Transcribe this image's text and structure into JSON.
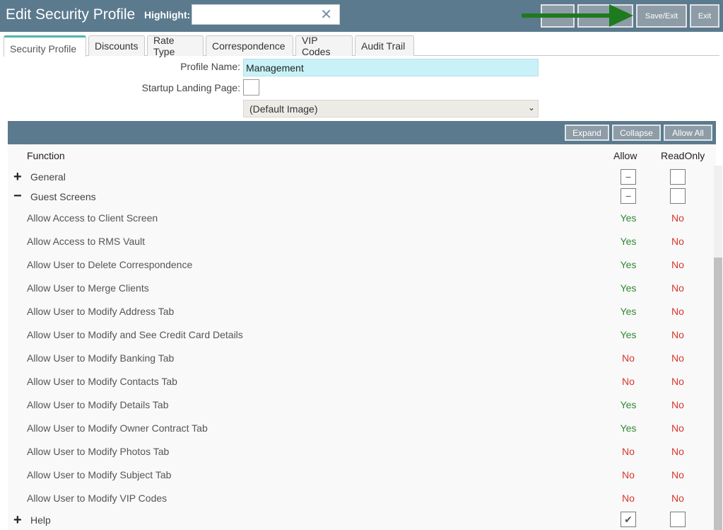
{
  "header": {
    "title": "Edit Security Profile",
    "highlight_label": "Highlight:",
    "highlight_value": "",
    "clear_icon": "close-icon",
    "buttons": [
      "",
      "",
      "Save/Exit",
      "Exit"
    ],
    "arrow_color": "#1e7a1e"
  },
  "tabs": [
    "Security Profile",
    "Discounts",
    "Rate Type",
    "Correspondence",
    "VIP Codes",
    "Audit Trail"
  ],
  "form": {
    "profile_name_label": "Profile Name:",
    "profile_name_value": "Management",
    "startup_label": "Startup Landing Page:",
    "image_select": "(Default Image)"
  },
  "grid": {
    "buttons": {
      "expand": "Expand",
      "collapse": "Collapse",
      "allow_all": "Allow All"
    },
    "columns": {
      "function": "Function",
      "allow": "Allow",
      "readonly": "ReadOnly"
    },
    "groups": {
      "general": "General",
      "guest_screens": "Guest Screens",
      "help": "Help"
    },
    "rows": [
      {
        "label": "Allow Access to Client Screen",
        "allow": "Yes",
        "readonly": "No"
      },
      {
        "label": "Allow Access to RMS Vault",
        "allow": "Yes",
        "readonly": "No"
      },
      {
        "label": "Allow User to Delete Correspondence",
        "allow": "Yes",
        "readonly": "No"
      },
      {
        "label": "Allow User to Merge Clients",
        "allow": "Yes",
        "readonly": "No"
      },
      {
        "label": "Allow User to Modify Address Tab",
        "allow": "Yes",
        "readonly": "No"
      },
      {
        "label": "Allow User to Modify and See Credit Card Details",
        "allow": "Yes",
        "readonly": "No"
      },
      {
        "label": "Allow User to Modify Banking Tab",
        "allow": "No",
        "readonly": "No"
      },
      {
        "label": "Allow User to Modify Contacts Tab",
        "allow": "No",
        "readonly": "No"
      },
      {
        "label": "Allow User to Modify Details Tab",
        "allow": "Yes",
        "readonly": "No"
      },
      {
        "label": "Allow User to Modify Owner Contract Tab",
        "allow": "Yes",
        "readonly": "No"
      },
      {
        "label": "Allow User to Modify Photos Tab",
        "allow": "No",
        "readonly": "No"
      },
      {
        "label": "Allow User to Modify Subject Tab",
        "allow": "No",
        "readonly": "No"
      },
      {
        "label": "Allow User to Modify VIP Codes",
        "allow": "No",
        "readonly": "No"
      }
    ],
    "partial_glyph": "−",
    "check_glyph": "✔"
  }
}
